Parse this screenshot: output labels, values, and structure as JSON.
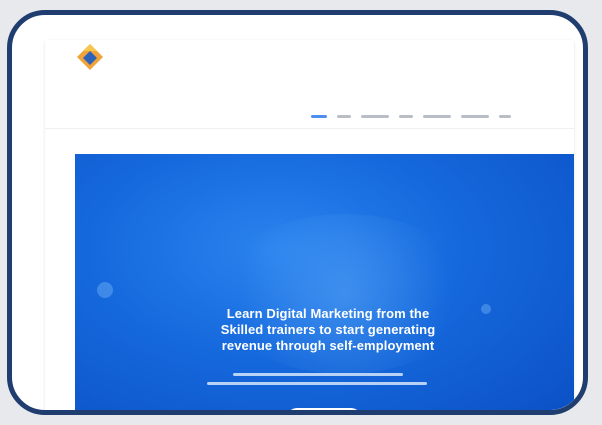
{
  "colors": {
    "frame": "#1f3d6f",
    "hero_blue": "#1568dc",
    "nav_active": "#4d8ef0",
    "logo_orange": "#f0a23b",
    "logo_blue": "#2c63b8"
  },
  "icons": {
    "logo": "diamond-logo"
  },
  "header": {
    "nav_items": [
      {
        "label": "",
        "active": true
      },
      {
        "label": "",
        "active": false
      },
      {
        "label": "",
        "active": false
      },
      {
        "label": "",
        "active": false
      },
      {
        "label": "",
        "active": false
      },
      {
        "label": "",
        "active": false
      },
      {
        "label": "",
        "active": false
      }
    ]
  },
  "hero": {
    "title_lines": [
      "Learn Digital Marketing from the",
      "Skilled trainers to start generating",
      "revenue through self-employment"
    ],
    "subtitle_lines": [
      "",
      ""
    ],
    "cta_label": ""
  }
}
